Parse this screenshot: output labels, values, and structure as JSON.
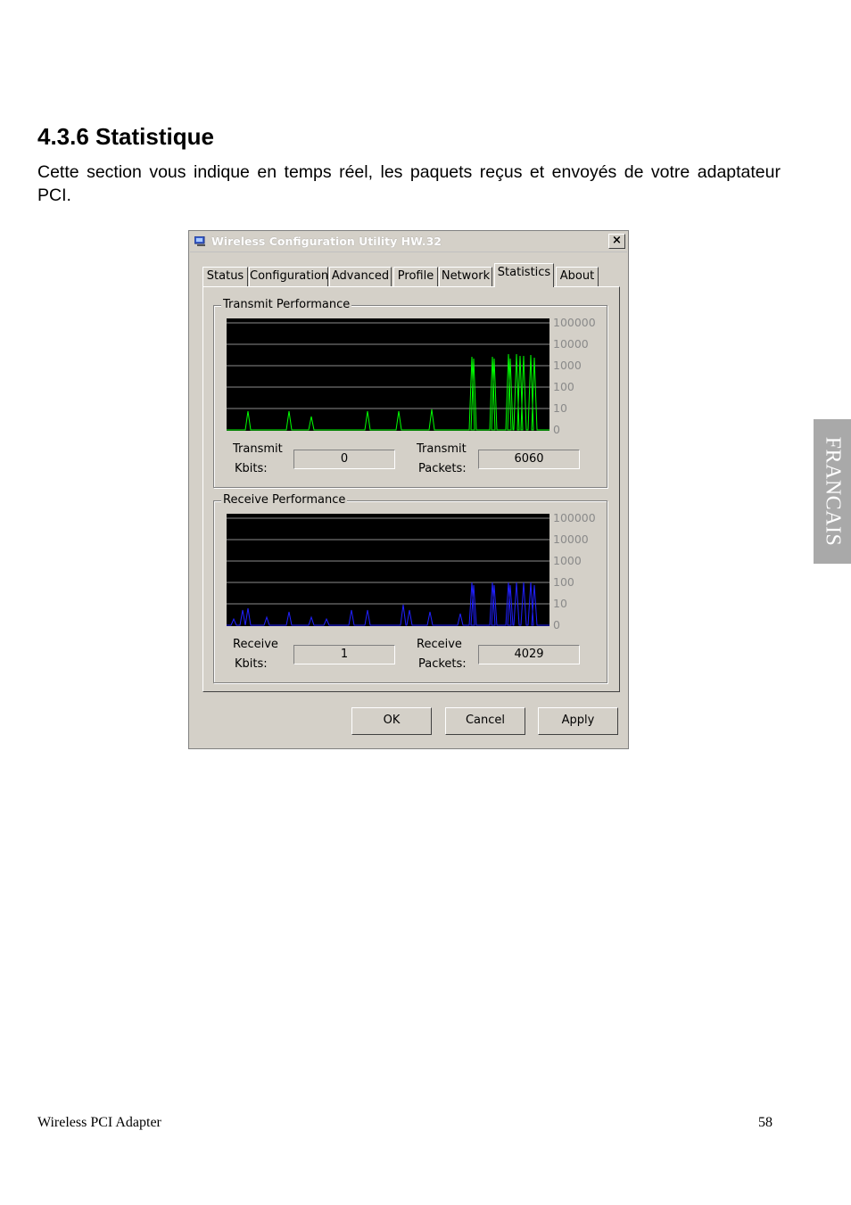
{
  "page": {
    "heading": "4.3.6 Statistique",
    "intro": "Cette section vous indique en temps réel, les paquets reçus et envoyés de votre adaptateur PCI.",
    "side_tab": "FRANCAIS",
    "footer_left": "Wireless PCI Adapter",
    "footer_right": "58"
  },
  "dialog": {
    "title": "Wireless Configuration Utility HW.32",
    "close_label": "×",
    "tabs": [
      "Status",
      "Configuration",
      "Advanced",
      "Profile",
      "Network",
      "Statistics",
      "About"
    ],
    "active_tab": "Statistics",
    "transmit": {
      "group_label": "Transmit Performance",
      "kbits_label_1": "Transmit",
      "kbits_label_2": "Kbits:",
      "kbits_value": "0",
      "packets_label_1": "Transmit",
      "packets_label_2": "Packets:",
      "packets_value": "6060",
      "line_color": "#00ff00"
    },
    "receive": {
      "group_label": "Receive Performance",
      "kbits_label_1": "Receive",
      "kbits_label_2": "Kbits:",
      "kbits_value": "1",
      "packets_label_1": "Receive",
      "packets_label_2": "Packets:",
      "packets_value": "4029",
      "line_color": "#2020ff"
    },
    "scale_labels": [
      "100000",
      "10000",
      "1000",
      "100",
      "10",
      "0"
    ],
    "buttons": {
      "ok": "OK",
      "cancel": "Cancel",
      "apply": "Apply"
    }
  }
}
